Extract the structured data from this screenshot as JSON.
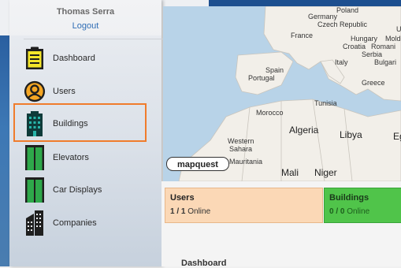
{
  "user": {
    "name": "Thomas Serra",
    "logout_label": "Logout"
  },
  "nav": {
    "items": [
      {
        "label": "Dashboard",
        "icon": "clipboard-icon"
      },
      {
        "label": "Users",
        "icon": "user-icon"
      },
      {
        "label": "Buildings",
        "icon": "building-icon",
        "selected": true
      },
      {
        "label": "Elevators",
        "icon": "elevator-icon"
      },
      {
        "label": "Car Displays",
        "icon": "car-display-icon"
      },
      {
        "label": "Companies",
        "icon": "companies-icon"
      }
    ]
  },
  "map": {
    "provider": "mapquest",
    "labels": [
      "Poland",
      "Germany",
      "Czech Republic",
      "France",
      "Hungary",
      "Mold",
      "Croatia",
      "Romani",
      "Serbia",
      "Bulgari",
      "Italy",
      "Spain",
      "Portugal",
      "Greece",
      "Tunisia",
      "Morocco",
      "Algeria",
      "Libya",
      "Eg",
      "Western",
      "Sahara",
      "Mauritania",
      "Mali",
      "Niger",
      "U"
    ]
  },
  "cards": {
    "users": {
      "title": "Users",
      "count": "1 / 1",
      "status": "Online"
    },
    "buildings": {
      "title": "Buildings",
      "count": "0 / 0",
      "status": "Online"
    }
  },
  "section_title": "Dashboard",
  "colors": {
    "accent_selected": "#f07c2c",
    "users_card": "#fbd8b6",
    "buildings_card": "#50c44a",
    "link": "#2f6db5"
  }
}
